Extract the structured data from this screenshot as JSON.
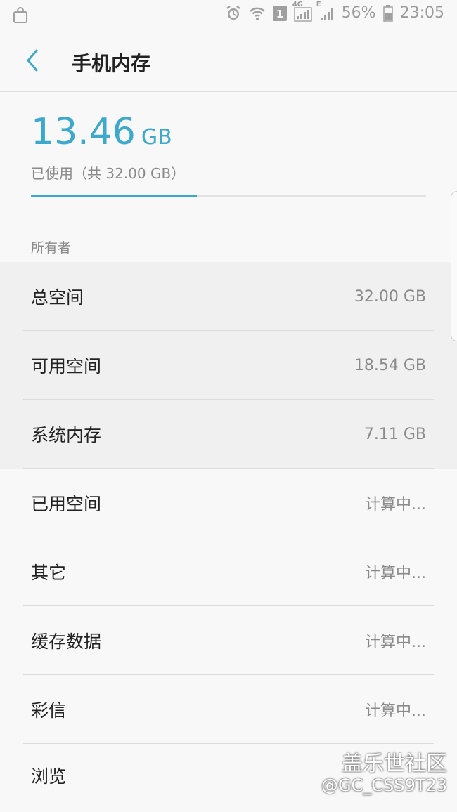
{
  "status_bar": {
    "left_icon": "shopping-bag-icon",
    "icons": [
      "alarm-icon",
      "wifi-icon",
      "sim1-icon"
    ],
    "network_4g": "4G",
    "network_e": "E",
    "battery": "56%",
    "time": "23:05"
  },
  "header": {
    "back_icon": "chevron-left-icon",
    "title": "手机内存"
  },
  "summary": {
    "used_value": "13.46",
    "used_unit": "GB",
    "used_caption": "已使用（共 32.00 GB）",
    "progress_fraction": 0.4206,
    "accent_color": "#3ba8cc"
  },
  "section": {
    "label": "所有者"
  },
  "rows": [
    {
      "label": "总空间",
      "value": "32.00 GB"
    },
    {
      "label": "可用空间",
      "value": "18.54 GB"
    },
    {
      "label": "系统内存",
      "value": "7.11 GB"
    },
    {
      "label": "已用空间",
      "value": "计算中..."
    },
    {
      "label": "其它",
      "value": "计算中..."
    },
    {
      "label": "缓存数据",
      "value": "计算中..."
    },
    {
      "label": "彩信",
      "value": "计算中..."
    },
    {
      "label": "浏览",
      "value": ""
    }
  ],
  "watermark": {
    "line1": "盖乐世社区",
    "line2": "@GC_CSS9T23"
  }
}
